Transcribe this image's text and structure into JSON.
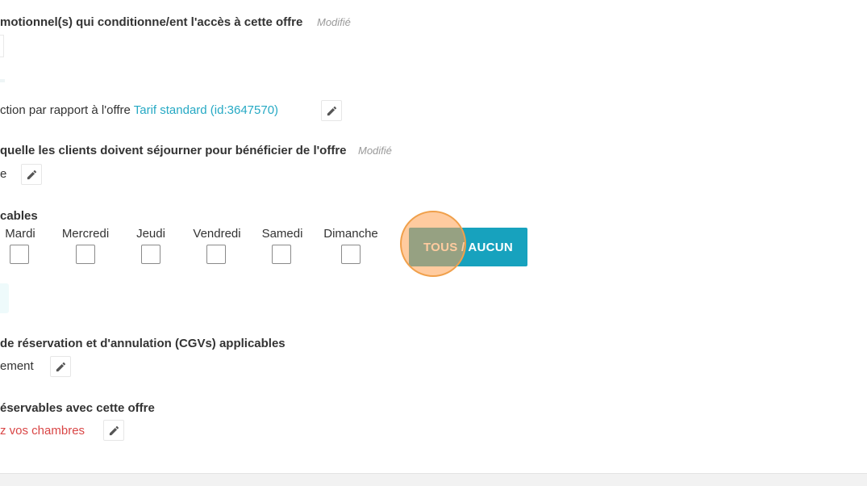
{
  "promo_section": {
    "heading": "motionnel(s) qui conditionne/ent l'accès à cette offre",
    "modified": "Modifié"
  },
  "reduction_section": {
    "text_prefix": "ction par rapport à l'offre ",
    "link": "Tarif standard (id:3647570)",
    "edit_icon": "pencil-icon"
  },
  "stay_period_section": {
    "heading": "quelle les clients doivent séjourner pour bénéficier de l'offre",
    "modified": "Modifié",
    "value": "e",
    "edit_icon": "pencil-icon"
  },
  "days_section": {
    "heading": "cables",
    "days": [
      {
        "label": "Mardi",
        "checked": false
      },
      {
        "label": "Mercredi",
        "checked": false
      },
      {
        "label": "Jeudi",
        "checked": false
      },
      {
        "label": "Vendredi",
        "checked": false
      },
      {
        "label": "Samedi",
        "checked": false
      },
      {
        "label": "Dimanche",
        "checked": false
      }
    ],
    "toggle_all_label": "TOUS / AUCUN",
    "toggle_color": "#17a2be"
  },
  "cgv_section": {
    "heading": "de réservation et d'annulation (CGVs) applicables",
    "value": "ement",
    "edit_icon": "pencil-icon"
  },
  "rooms_section": {
    "heading": "éservables avec cette offre",
    "value": "z vos chambres",
    "value_color": "#d94646",
    "edit_icon": "pencil-icon"
  },
  "colors": {
    "link": "#26a9c4",
    "click_marker": "#f0a04b"
  }
}
